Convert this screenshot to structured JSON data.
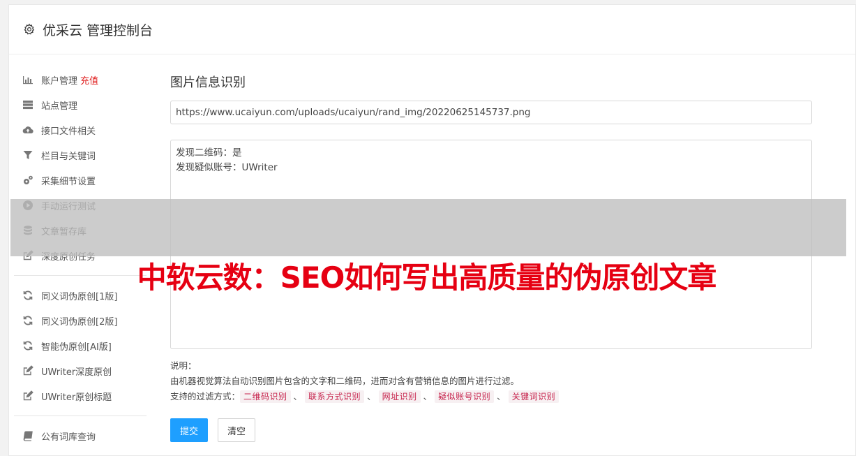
{
  "header": {
    "title": "优采云 管理控制台",
    "icon": "gear-icon"
  },
  "sidebar": {
    "group1": [
      {
        "label": "账户管理",
        "badge": "充值",
        "icon": "bar-chart-icon"
      },
      {
        "label": "站点管理",
        "icon": "server-icon"
      },
      {
        "label": "接口文件相关",
        "icon": "cloud-upload-icon"
      },
      {
        "label": "栏目与关键词",
        "icon": "filter-icon"
      },
      {
        "label": "采集细节设置",
        "icon": "cogs-icon"
      },
      {
        "label": "手动运行测试",
        "icon": "play-circle-icon"
      },
      {
        "label": "文章暂存库",
        "icon": "database-icon"
      },
      {
        "label": "深度原创任务",
        "icon": "edit-icon"
      }
    ],
    "group2": [
      {
        "label": "同义词伪原创[1版]",
        "icon": "refresh-icon"
      },
      {
        "label": "同义词伪原创[2版]",
        "icon": "refresh-icon"
      },
      {
        "label": "智能伪原创[AI版]",
        "icon": "refresh-icon"
      },
      {
        "label": "UWriter深度原创",
        "icon": "edit-icon"
      },
      {
        "label": "UWriter原创标题",
        "icon": "edit-icon"
      }
    ],
    "group3": [
      {
        "label": "公有词库查询",
        "icon": "book-icon"
      }
    ]
  },
  "main": {
    "section_title": "图片信息识别",
    "url_value": "https://www.ucaiyun.com/uploads/ucaiyun/rand_img/20220625145737.png",
    "result_text": "发现二维码：是\n发现疑似账号：UWriter",
    "notes_label": "说明：",
    "notes_desc": "由机器视觉算法自动识别图片包含的文字和二维码，进而对含有营销信息的图片进行过滤。",
    "filter_label": "支持的过滤方式：",
    "filter_tags": [
      "二维码识别",
      "联系方式识别",
      "网址识别",
      "疑似账号识别",
      "关键词识别"
    ],
    "separator": "、",
    "submit_label": "提交",
    "clear_label": "清空"
  },
  "overlay": {
    "text": "中软云数：SEO如何写出高质量的伪原创文章"
  },
  "colors": {
    "primary": "#1e9fff",
    "badge": "#e02020",
    "overlay_text": "#e60012",
    "tag_text": "#c7254e"
  }
}
